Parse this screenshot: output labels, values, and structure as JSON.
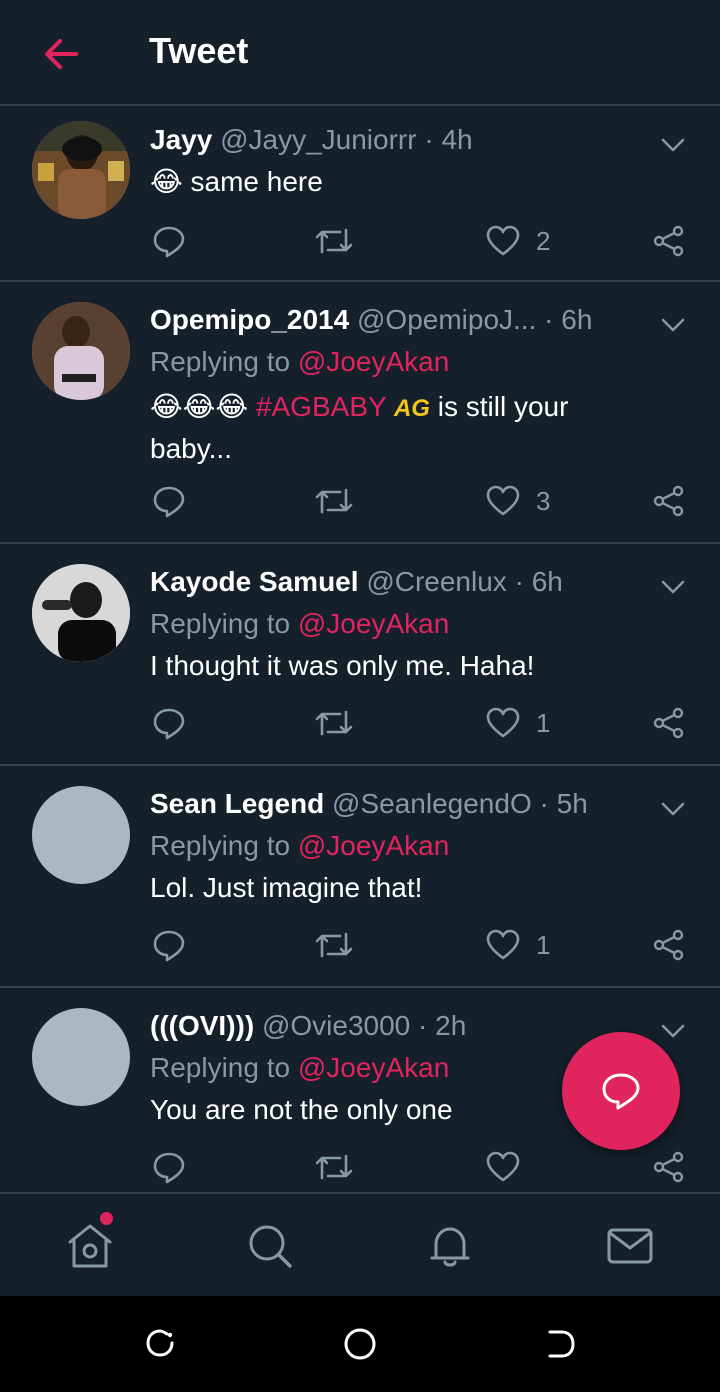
{
  "header": {
    "title": "Tweet",
    "back_icon": "arrow-left-icon",
    "accent": "#e0245e"
  },
  "colors": {
    "background": "#15202b",
    "divider": "#38444d",
    "muted": "#8899a6",
    "accent": "#e0245e"
  },
  "tweets": [
    {
      "name": "Jayy",
      "handle": "@Jayy_Juniorrr",
      "dot": "·",
      "time": "4h",
      "emoji": "😂",
      "text": " same here",
      "counts": {
        "like": "2"
      }
    },
    {
      "name": "Opemipo_2014",
      "handle": "@OpemipoJ...",
      "dot": "·",
      "time": "6h",
      "reply_prefix": "Replying to",
      "reply_mention": "@JoeyAkan",
      "emoji": "😂😂😂",
      "hashtag": "#AGBABY",
      "badge": "AG",
      "text": " is still your baby...",
      "counts": {
        "like": "3"
      }
    },
    {
      "name": "Kayode Samuel",
      "handle": "@Creenlux",
      "dot": "·",
      "time": "6h",
      "reply_prefix": "Replying to",
      "reply_mention": "@JoeyAkan",
      "text": "I thought it was only me. Haha!",
      "counts": {
        "like": "1"
      }
    },
    {
      "name": "Sean Legend",
      "handle": "@SeanlegendO",
      "dot": "·",
      "time": "5h",
      "reply_prefix": "Replying to",
      "reply_mention": "@JoeyAkan",
      "text": "Lol. Just imagine that!",
      "counts": {
        "like": "1"
      }
    },
    {
      "name": "(((OVI)))",
      "handle": "@Ovie3000",
      "dot": "·",
      "time": "2h",
      "reply_prefix": "Replying to",
      "reply_mention": "@JoeyAkan",
      "text": "You are not the only one",
      "counts": {
        "like": ""
      }
    }
  ],
  "icons": {
    "reply": "reply-icon",
    "retweet": "retweet-icon",
    "like": "heart-icon",
    "share": "share-icon",
    "more": "chevron-down-icon",
    "compose": "compose-reply-icon"
  },
  "bottom_nav": [
    {
      "name": "home",
      "icon": "home-icon",
      "has_notification_dot": true
    },
    {
      "name": "search",
      "icon": "search-icon"
    },
    {
      "name": "notifications",
      "icon": "bell-icon"
    },
    {
      "name": "messages",
      "icon": "mail-icon"
    }
  ],
  "system_nav": [
    "recents-icon",
    "home-circle-icon",
    "back-icon"
  ]
}
